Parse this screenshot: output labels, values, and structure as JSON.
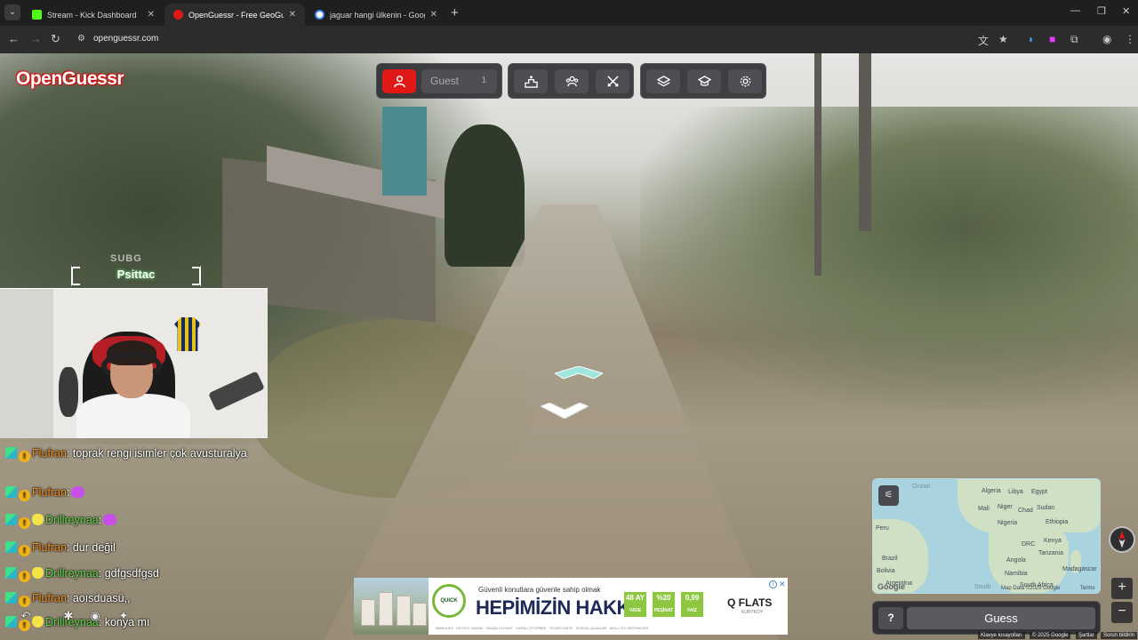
{
  "browser": {
    "tabs": [
      {
        "title": "Stream - Kick Dashboard",
        "favicon_color": "#53fc18"
      },
      {
        "title": "OpenGuessr - Free GeoGuessr Alt",
        "favicon_color": "#e01818"
      },
      {
        "title": "jaguar hangi ülkenin - Google'da",
        "favicon_color": "#4285f4"
      }
    ],
    "url": "openguessr.com"
  },
  "game": {
    "logo": "OpenGuessr",
    "player": {
      "name": "Guest",
      "count": "1"
    },
    "guess_label": "Guess",
    "help_label": "?",
    "accent": "#e01818"
  },
  "minimap": {
    "labels": [
      "Algeria",
      "Libya",
      "Egypt",
      "Mali",
      "Niger",
      "Chad",
      "Sudan",
      "Nigeria",
      "Ethiopia",
      "DRC",
      "Kenya",
      "Tanzania",
      "Angola",
      "Namibia",
      "Madagascar",
      "South Africa",
      "Peru",
      "Brazil",
      "Bolivia",
      "Argentina"
    ],
    "oceans": [
      "Ocean",
      "South"
    ],
    "footer": {
      "credit": "Map Data ©2025 Google",
      "terms": "Terms"
    }
  },
  "footer": {
    "shortcuts": "Klavye kısayolları",
    "copyright": "© 2025 Google",
    "terms": "Şartlar",
    "report": "Sorun bildirin"
  },
  "ad": {
    "small_text": "Güvenli konutlara güvenle sahip olmak",
    "headline": "HEPİMİZİN HAKKI",
    "badge": "QUICK",
    "tags": [
      {
        "line1": "48 AY",
        "line2": "VADE"
      },
      {
        "line1": "%20",
        "line2": "PEŞİNAT"
      },
      {
        "line1": "0,99",
        "line2": "FAİZ"
      }
    ],
    "brand": "Q FLATS",
    "brand_sub": "KURTKÖY",
    "fineprint": "BANKASIZ · KEYİFLİ YAŞAM · İSKANLI KONUT · KAPALI OTOPARK · TİCARİ ÜNİTE · SOSYAL ALANLAR · AKILLI EV SİSTEMLERİ"
  },
  "stream": {
    "sub_tag": "SUBG",
    "sub_name": "Psittac",
    "chat": [
      {
        "user": "Flufran",
        "color": "orange",
        "badges": [
          "sub",
          "og"
        ],
        "text": ": toprak rengi isimler çok avusturalya",
        "emote": false
      },
      {
        "user": "Flufran",
        "color": "orange",
        "badges": [
          "sub",
          "og"
        ],
        "text": ":",
        "emote": true
      },
      {
        "user": "Drillreynaa",
        "color": "green",
        "badges": [
          "sub",
          "og",
          "pika"
        ],
        "text": ":",
        "emote": true
      },
      {
        "user": "Flufran",
        "color": "orange",
        "badges": [
          "sub",
          "og"
        ],
        "text": ": dur değil",
        "emote": false
      },
      {
        "user": "Drillreynaa",
        "color": "green",
        "badges": [
          "sub",
          "og",
          "pika"
        ],
        "text": ": gdfgsdfgsd",
        "emote": false
      },
      {
        "user": "Flufran",
        "color": "orange",
        "badges": [
          "sub",
          "og"
        ],
        "text": ": aoısduasü,,",
        "emote": false
      },
      {
        "user": "Drillreynaa",
        "color": "green",
        "badges": [
          "sub",
          "og",
          "pika"
        ],
        "text": ": konya mı",
        "emote": false
      }
    ]
  }
}
